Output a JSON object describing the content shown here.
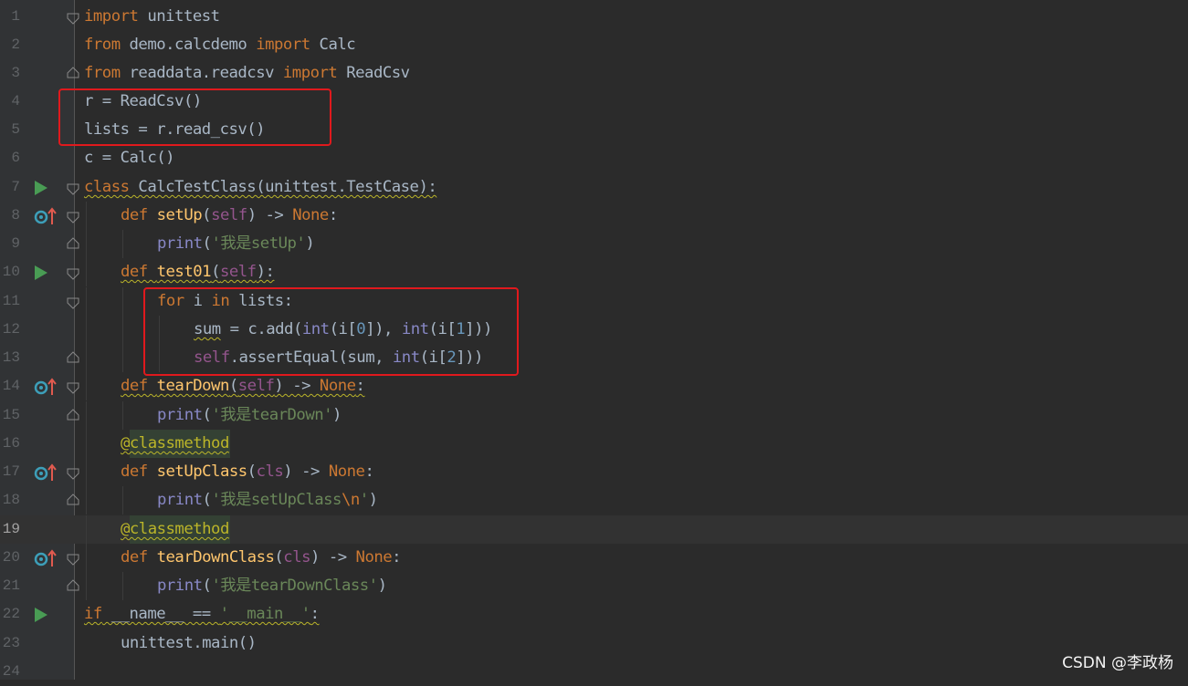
{
  "editor": {
    "line_numbers": [
      "1",
      "2",
      "3",
      "4",
      "5",
      "6",
      "7",
      "8",
      "9",
      "10",
      "11",
      "12",
      "13",
      "14",
      "15",
      "16",
      "17",
      "18",
      "19",
      "20",
      "21",
      "22",
      "23",
      "24"
    ],
    "current_line": 19,
    "code": {
      "l1": {
        "t1": "import",
        "t2": " unittest"
      },
      "l2": {
        "t1": "from",
        "t2": " demo.calcdemo ",
        "t3": "import",
        "t4": " Calc"
      },
      "l3": {
        "t1": "from",
        "t2": " readdata.readcsv ",
        "t3": "import",
        "t4": " ReadCsv"
      },
      "l4": {
        "t1": "r = ReadCsv()"
      },
      "l5": {
        "t1": "lists = r.read_csv()"
      },
      "l6": {
        "t1": "c = Calc()"
      },
      "l7": {
        "t1": "class",
        "t2": " CalcTestClass(unittest.TestCase):"
      },
      "l8": {
        "t1": "def ",
        "t2": "setUp",
        "t3": "(",
        "t4": "self",
        "t5": ") -> ",
        "t6": "None",
        ":": ":"
      },
      "l9": {
        "t1": "print",
        "t2": "(",
        "t3": "'我是setUp'",
        "t4": ")"
      },
      "l10": {
        "t1": "def ",
        "t2": "test01",
        "t3": "(",
        "t4": "self",
        "t5": "):"
      },
      "l11": {
        "t1": "for",
        "t2": " i ",
        "t3": "in",
        "t4": " lists:"
      },
      "l12": {
        "t1": "sum",
        "t2": " = c.add(",
        "t3": "int",
        "t4": "(i[",
        "t5": "0",
        "t6": "]), ",
        "t7": "int",
        "t8": "(i[",
        "t9": "1",
        "t10": "]))"
      },
      "l13": {
        "t1": "self",
        "t2": ".assertEqual(sum, ",
        "t3": "int",
        "t4": "(i[",
        "t5": "2",
        "t6": "]))"
      },
      "l14": {
        "t1": "def ",
        "t2": "tearDown",
        "t3": "(",
        "t4": "self",
        "t5": ") -> ",
        "t6": "None",
        ":": ":"
      },
      "l15": {
        "t1": "print",
        "t2": "(",
        "t3": "'我是tearDown'",
        "t4": ")"
      },
      "l16": {
        "t1": "@classmethod"
      },
      "l17": {
        "t1": "def ",
        "t2": "setUpClass",
        "t3": "(",
        "t4": "cls",
        "t5": ") -> ",
        "t6": "None",
        ":": ":"
      },
      "l18": {
        "t1": "print",
        "t2": "(",
        "t3": "'我是setUpClass",
        "t4": "\\n",
        "t5": "'",
        "t6": ")"
      },
      "l19": {
        "t1": "@classmethod"
      },
      "l20": {
        "t1": "def ",
        "t2": "tearDownClass",
        "t3": "(",
        "t4": "cls",
        "t5": ") -> ",
        "t6": "None",
        ":": ":"
      },
      "l21": {
        "t1": "print",
        "t2": "(",
        "t3": "'我是tearDownClass'",
        "t4": ")"
      },
      "l22": {
        "t1": "if",
        "t2": " __name__ == ",
        "t3": "'__main__'",
        ":": ":"
      },
      "l23": {
        "t1": "unittest.main()"
      }
    }
  },
  "colors": {
    "background": "#2b2b2b",
    "keyword": "#cc7832",
    "string": "#6a8759",
    "number": "#6897bb",
    "self": "#94558d",
    "function": "#ffc66d",
    "builtin": "#8888c6",
    "decorator": "#bbb529",
    "highlight_box": "#e0191d"
  },
  "icons": {
    "run": "run-triangle-icon",
    "override": "override-up-arrow-icon",
    "fold": "fold-marker-icon"
  },
  "watermark": "CSDN @李政杨"
}
